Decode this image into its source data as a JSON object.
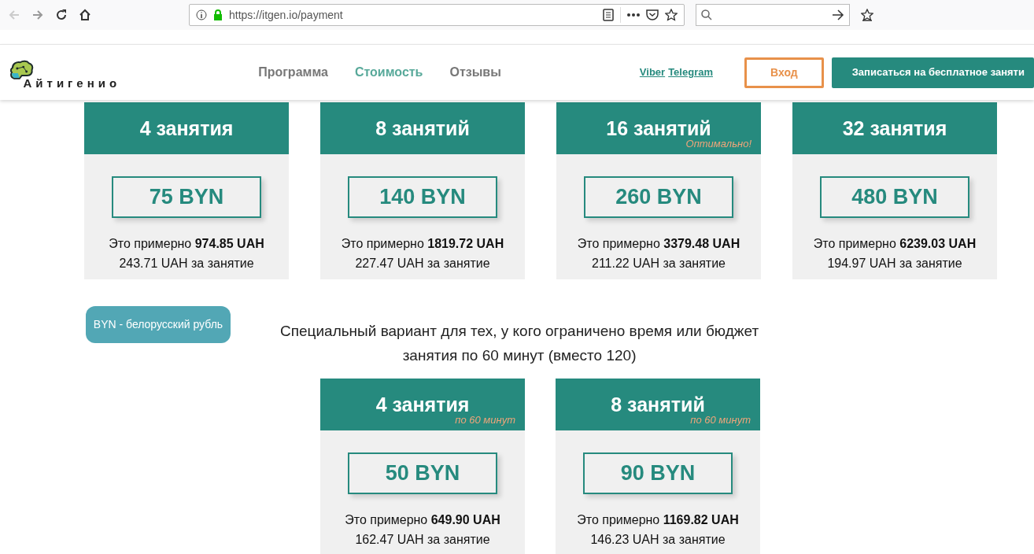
{
  "browser": {
    "url": "https://itgen.io/payment"
  },
  "header": {
    "logo_text": "Айтигенио",
    "nav": [
      {
        "label": "Программа",
        "selected": false
      },
      {
        "label": "Стоимость",
        "selected": true
      },
      {
        "label": "Отзывы",
        "selected": false
      }
    ],
    "messengers": [
      "Viber",
      "Telegram"
    ],
    "login_button": "Вход",
    "signup_button": "Записаться на бесплатное заняти"
  },
  "plans": [
    {
      "title": "4 занятия",
      "price": "75 BYN",
      "approx_prefix": "Это примерно",
      "approx": "974.85 UAH",
      "per_lesson": "243.71 UAH за занятие"
    },
    {
      "title": "8 занятий",
      "price": "140 BYN",
      "approx_prefix": "Это примерно",
      "approx": "1819.72 UAH",
      "per_lesson": "227.47 UAH за занятие"
    },
    {
      "title": "16 занятий",
      "note": "Оптимально!",
      "price": "260 BYN",
      "approx_prefix": "Это примерно",
      "approx": "3379.48 UAH",
      "per_lesson": "211.22 UAH за занятие"
    },
    {
      "title": "32 занятия",
      "price": "480 BYN",
      "approx_prefix": "Это примерно",
      "approx": "6239.03 UAH",
      "per_lesson": "194.97 UAH за занятие"
    }
  ],
  "currency_badge": "BYN - белорусский рубль",
  "special": {
    "line1": "Специальный вариант для тех, у кого ограничено время или бюджет",
    "line2": "занятия по 60 минут (вместо 120)"
  },
  "short_plans": [
    {
      "title": "4 занятия",
      "note": "по 60 минут",
      "price": "50 BYN",
      "approx_prefix": "Это примерно",
      "approx": "649.90 UAH",
      "per_lesson": "162.47 UAH за занятие"
    },
    {
      "title": "8 занятий",
      "note": "по 60 минут",
      "price": "90 BYN",
      "approx_prefix": "Это примерно",
      "approx": "1169.82 UAH",
      "per_lesson": "146.23 UAH за занятие"
    }
  ]
}
